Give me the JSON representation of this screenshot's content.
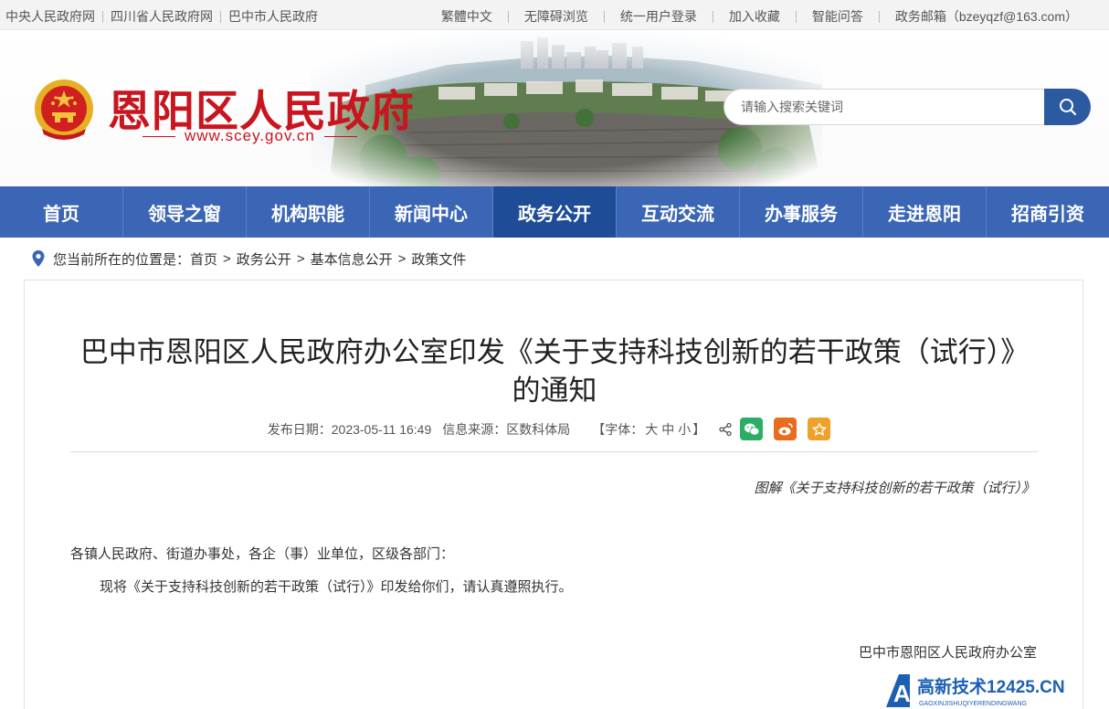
{
  "topbar": {
    "left_links": [
      "中央人民政府网",
      "四川省人民政府网",
      "巴中市人民政府"
    ],
    "right_links": [
      "繁體中文",
      "无障碍浏览",
      "统一用户登录",
      "加入收藏",
      "智能问答",
      "政务邮箱（bzeyqzf@163.com）"
    ]
  },
  "header": {
    "site_name": "恩阳区人民政府",
    "site_url": "www.scey.gov.cn",
    "search_placeholder": "请输入搜索关键词"
  },
  "nav": {
    "items": [
      "首页",
      "领导之窗",
      "机构职能",
      "新闻中心",
      "政务公开",
      "互动交流",
      "办事服务",
      "走进恩阳",
      "招商引资"
    ],
    "active": "政务公开"
  },
  "breadcrumb": {
    "prefix": "您当前所在的位置是：",
    "items": [
      "首页",
      "政务公开",
      "基本信息公开",
      "政策文件"
    ],
    "separator": ">"
  },
  "article": {
    "title": "巴中市恩阳区人民政府办公室印发《关于支持科技创新的若干政策（试行）》的通知",
    "publish_label": "发布日期：",
    "publish_date": "2023-05-11 16:49",
    "source_label": "信息来源：",
    "source": "区数科体局",
    "font_open": "【字体：",
    "font_large": "大",
    "font_medium": "中",
    "font_small": "小",
    "font_close": "】",
    "graphic_link": "图解《关于支持科技创新的若干政策（试行）》",
    "addressee": "各镇人民政府、街道办事处，各企（事）业单位，区级各部门：",
    "body": "现将《关于支持科技创新的若干政策（试行）》印发给你们，请认真遵照执行。",
    "signoff": "巴中市恩阳区人民政府办公室"
  },
  "watermark": {
    "text": "高新技术12425.CN",
    "sub": "GAOXINJISHUQIYERENDINGWANG"
  },
  "colors": {
    "nav_bg": "#3b66b5",
    "nav_active": "#1e4c96",
    "brand_red": "#c9151e",
    "wechat": "#2aae67",
    "weibo": "#e96b1e",
    "favorite": "#f0a12a"
  }
}
